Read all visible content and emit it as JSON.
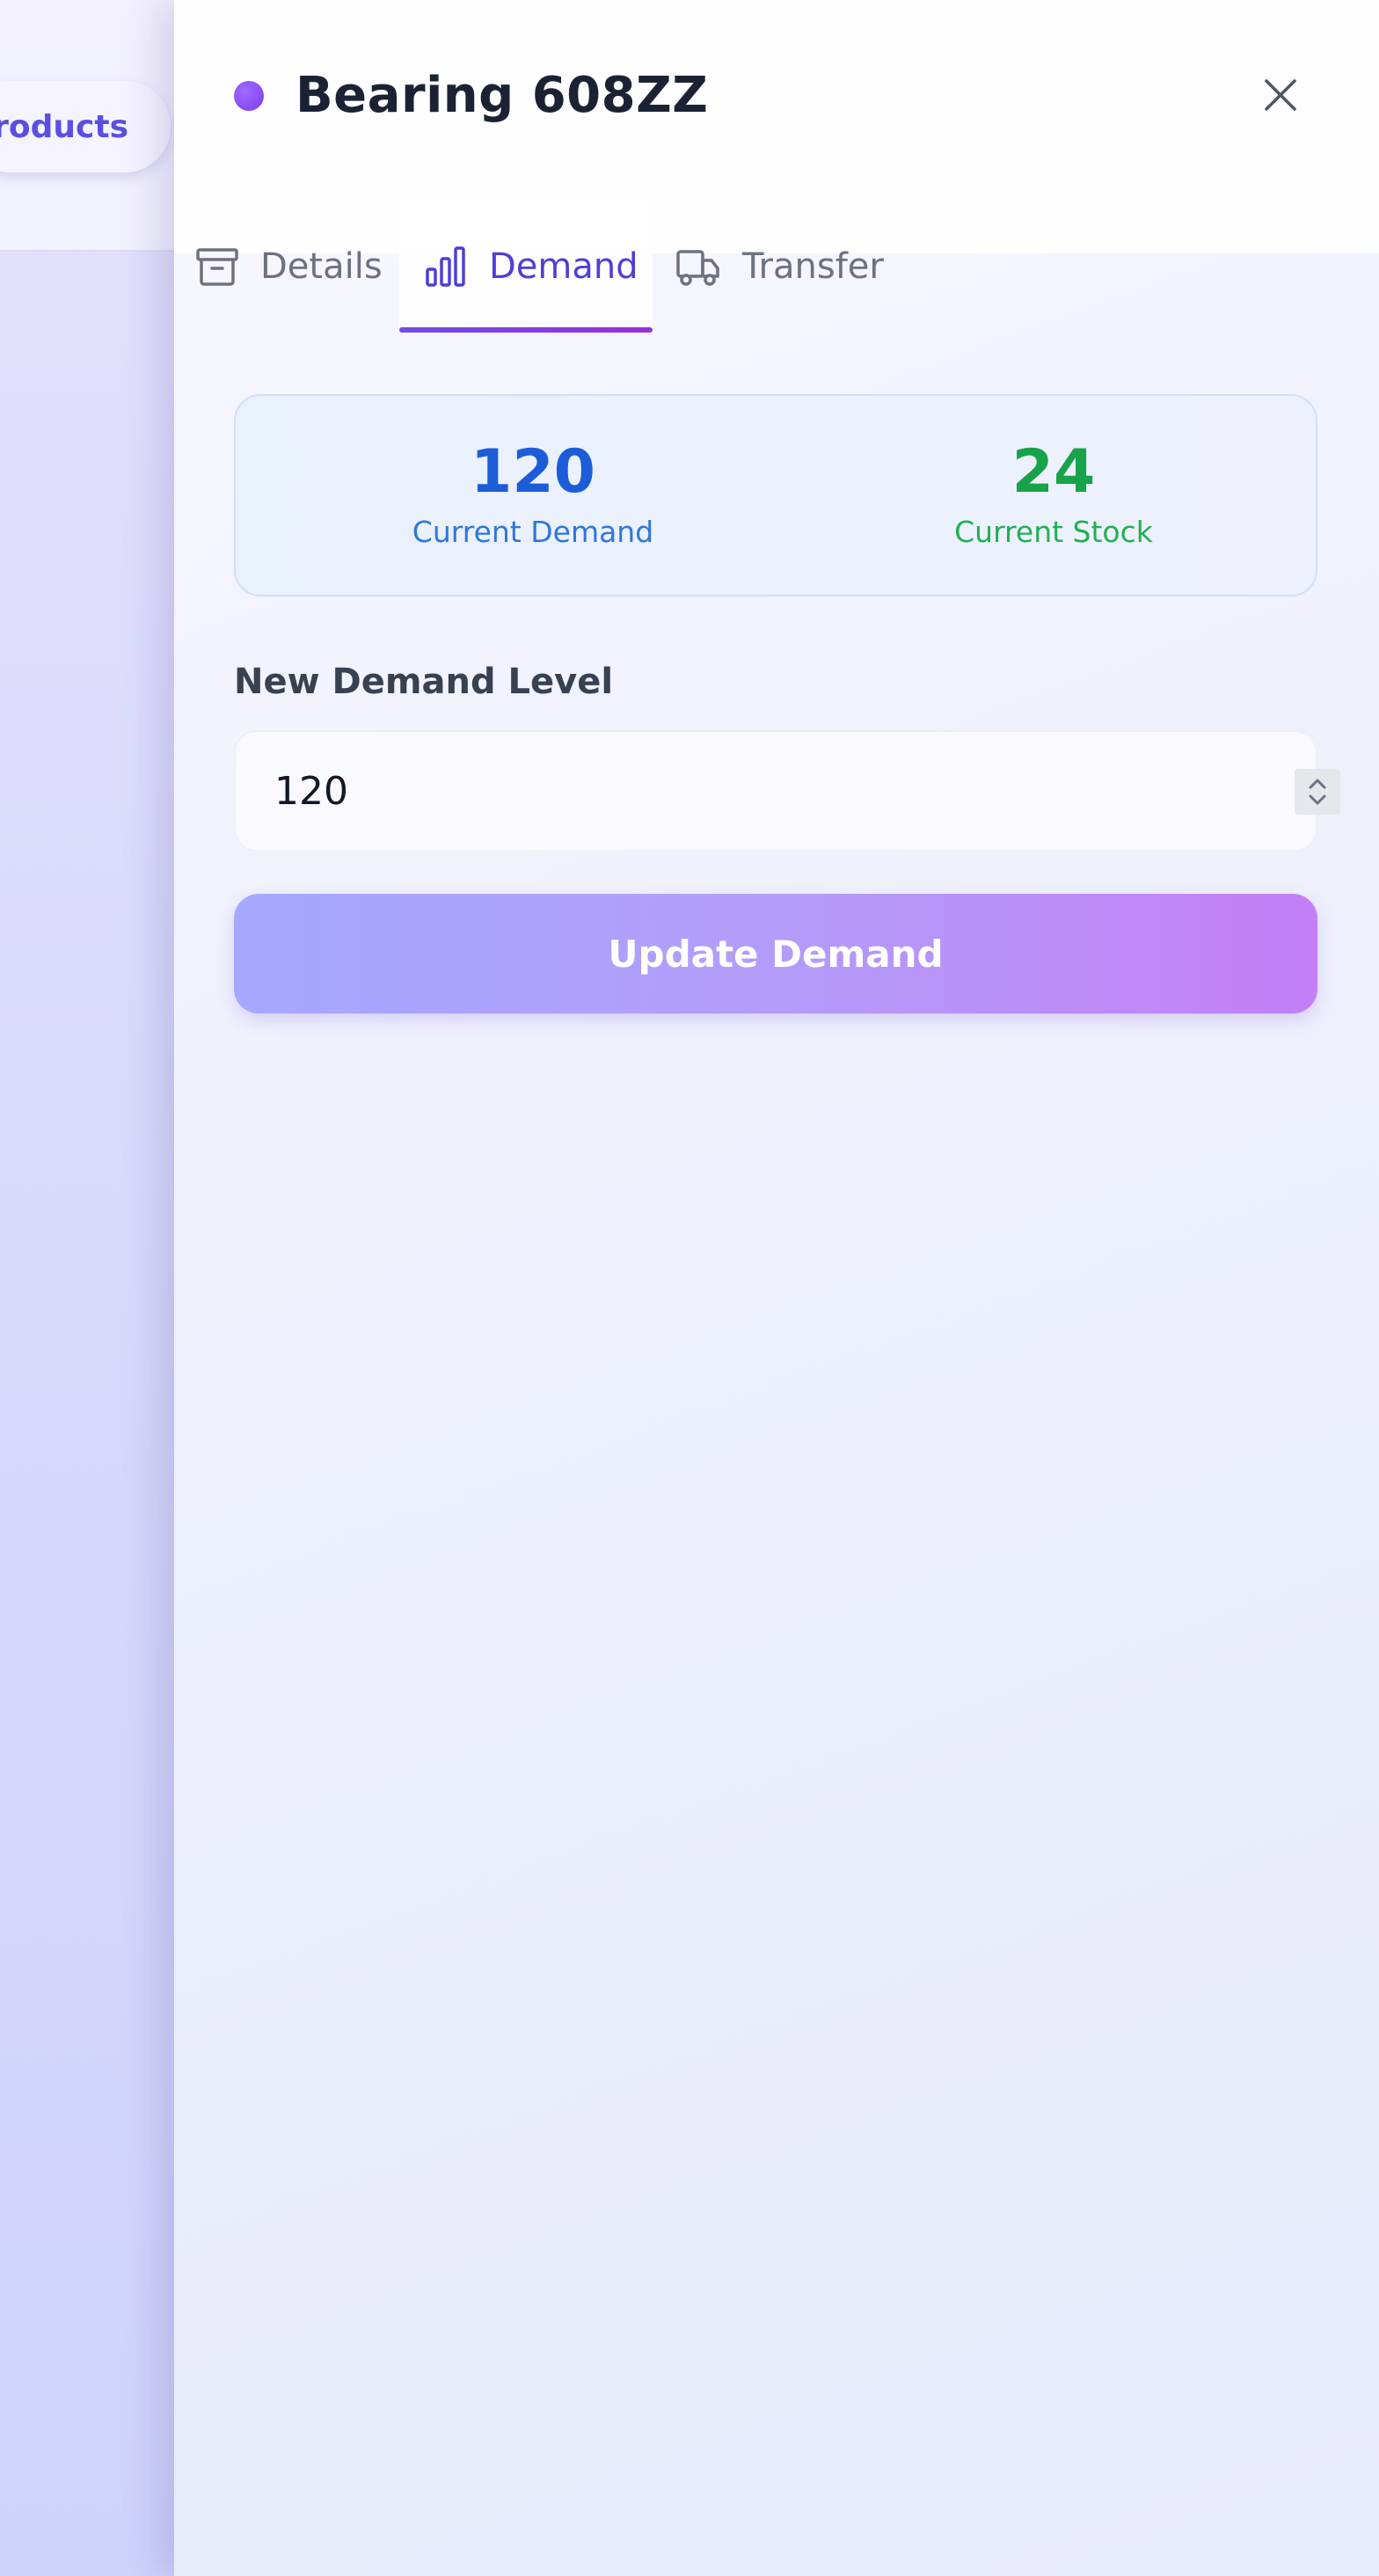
{
  "background": {
    "products_button_label": "Products"
  },
  "panel": {
    "title": "Bearing 608ZZ",
    "status_color": "#8b5cf6",
    "tabs": [
      {
        "label": "Details",
        "icon": "archive-box-icon",
        "active": false
      },
      {
        "label": "Demand",
        "icon": "bar-chart-icon",
        "active": true
      },
      {
        "label": "Transfer",
        "icon": "truck-icon",
        "active": false
      }
    ],
    "stats": {
      "current_demand_value": "120",
      "current_demand_label": "Current Demand",
      "current_stock_value": "24",
      "current_stock_label": "Current Stock"
    },
    "form": {
      "field_label": "New Demand Level",
      "input_value": "120",
      "submit_label": "Update Demand"
    }
  },
  "colors": {
    "accent": "#4f3ed6",
    "demand_blue": "#1d5cd9",
    "stock_green": "#16a34a"
  }
}
